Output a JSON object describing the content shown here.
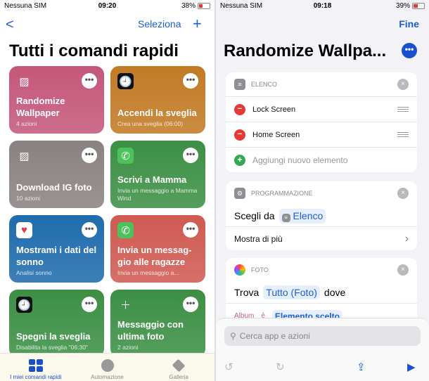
{
  "left": {
    "status": {
      "carrier": "Nessuna SIM",
      "time": "09:20",
      "battery": "38%"
    },
    "nav": {
      "back": "<",
      "select": "Seleziona",
      "add": "+"
    },
    "title": "Tutti i comandi rapidi",
    "cards": [
      {
        "name": "Randomize Wallpaper",
        "sub": "4 azioni",
        "color": "#c4577a",
        "icon": "photo-icon"
      },
      {
        "name": "Accendi la sveglia",
        "sub": "Crea una sveglia (06:00)",
        "color": "#c27a25",
        "icon": "clock-icon"
      },
      {
        "name": "Download IG foto",
        "sub": "10 azioni",
        "color": "#8a8280",
        "icon": "photo-icon"
      },
      {
        "name": "Scrivi a Mamma",
        "sub": "Invia un messaggio a Mamma Wind",
        "color": "#3c8f45",
        "icon": "whatsapp-icon"
      },
      {
        "name": "Mostrami i dati del sonno",
        "sub": "Analisi sonno",
        "color": "#1f6cad",
        "icon": "heart-icon"
      },
      {
        "name": "Invia un messag-gio alle ragazze",
        "sub": "Invia un messaggio a...",
        "color": "#cf5a52",
        "icon": "whatsapp-icon"
      },
      {
        "name": "Spegni la sveglia",
        "sub": "Disabilita la sveglia \"06:30\"",
        "color": "#3c8f45",
        "icon": "clock-icon"
      },
      {
        "name": "Messaggio con ultima foto",
        "sub": "2 azioni",
        "color": "#3c8f45",
        "icon": "message-plus-icon"
      }
    ],
    "tabs": [
      {
        "label": "I miei comandi rapidi",
        "active": true
      },
      {
        "label": "Automazione"
      },
      {
        "label": "Galleria"
      }
    ]
  },
  "right": {
    "status": {
      "carrier": "Nessuna SIM",
      "time": "09:18",
      "battery": "39%"
    },
    "done": "Fine",
    "title": "Randomize Wallpa...",
    "list_action": {
      "header": "ELENCO",
      "items": [
        "Lock Screen",
        "Home Screen"
      ],
      "add": "Aggiungi nuovo elemento"
    },
    "choose_action": {
      "header": "PROGRAMMAZIONE",
      "text": "Scegli da",
      "variable": "Elenco",
      "more": "Mostra di più"
    },
    "photos_action": {
      "header": "FOTO",
      "find": "Trova",
      "param": "Tutto (Foto)",
      "where": "dove",
      "filter_field": "Album",
      "filter_op": "è",
      "filter_value": "Elemento scelto"
    },
    "search_placeholder": "Cerca app e azioni"
  },
  "accent": "#1a5fd6"
}
